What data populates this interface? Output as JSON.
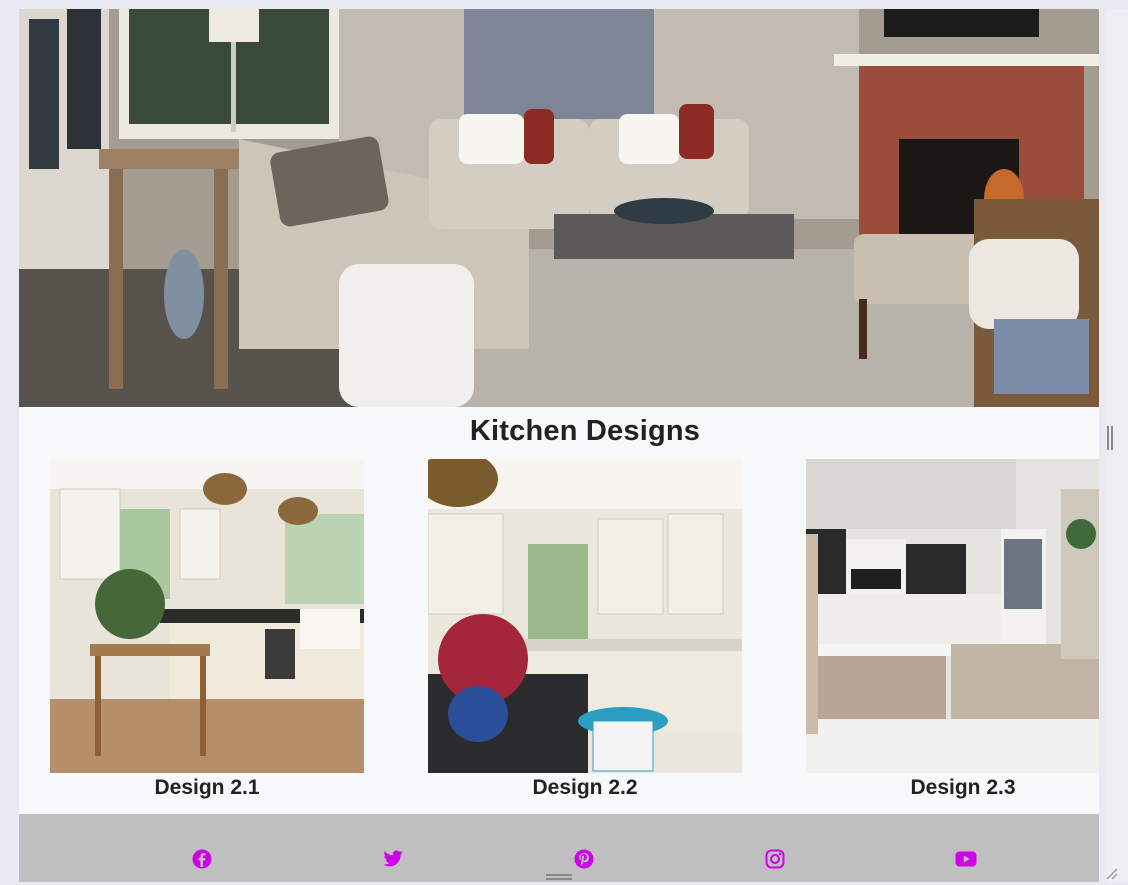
{
  "section": {
    "title": "Kitchen Designs"
  },
  "designs": [
    {
      "caption": "Design 2.1"
    },
    {
      "caption": "Design 2.2"
    },
    {
      "caption": "Design 2.3"
    }
  ],
  "footer": {
    "social": [
      {
        "icon": "facebook-icon"
      },
      {
        "icon": "twitter-icon"
      },
      {
        "icon": "pinterest-icon"
      },
      {
        "icon": "instagram-icon"
      },
      {
        "icon": "youtube-icon"
      }
    ],
    "icon_color": "#d000e8",
    "background": "#bfbfbf"
  },
  "colors": {
    "page": "#f7f8fa",
    "heading": "#222222"
  }
}
